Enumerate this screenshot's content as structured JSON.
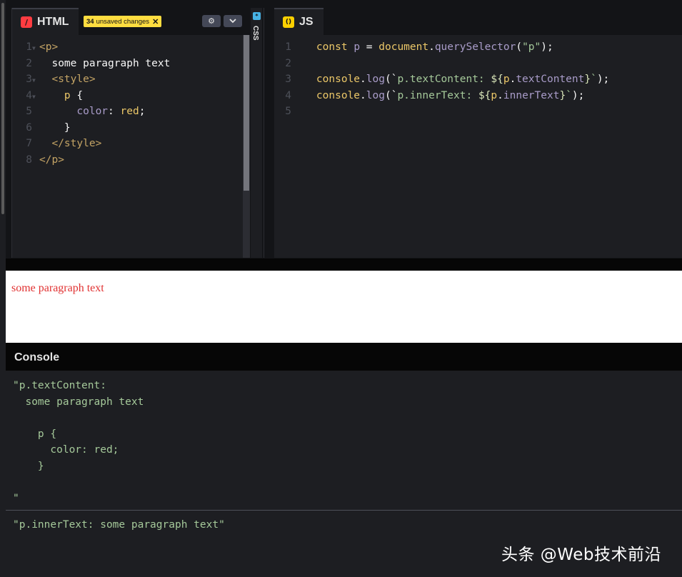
{
  "html_panel": {
    "tab_label": "HTML",
    "tab_icon": "/",
    "unsaved_count": "34",
    "unsaved_text": "unsaved changes",
    "lines": [
      {
        "n": "1",
        "fold": true
      },
      {
        "n": "2",
        "fold": false
      },
      {
        "n": "3",
        "fold": true
      },
      {
        "n": "4",
        "fold": true
      },
      {
        "n": "5",
        "fold": false
      },
      {
        "n": "6",
        "fold": false
      },
      {
        "n": "7",
        "fold": false
      },
      {
        "n": "8",
        "fold": false
      }
    ],
    "code": {
      "l1_tag": "<p>",
      "l2_text": "some paragraph text",
      "l3_tag": "<style>",
      "l4_sel": "p",
      "l4_brace": "{",
      "l5_prop": "color",
      "l5_colon": ":",
      "l5_val": "red",
      "l5_semi": ";",
      "l6_brace": "}",
      "l7_tag": "</style>",
      "l8_tag": "</p>"
    }
  },
  "css_strip": {
    "label": "CSS",
    "icon": "*"
  },
  "js_panel": {
    "tab_label": "JS",
    "tab_icon": "()",
    "line_numbers": [
      "1",
      "2",
      "3",
      "4",
      "5"
    ],
    "code": {
      "l1_kw": "const",
      "l1_var": "p",
      "l1_eq": "=",
      "l1_obj": "document",
      "l1_dot": ".",
      "l1_fn": "querySelector",
      "l1_open": "(",
      "l1_str": "\"p\"",
      "l1_close": ");",
      "l3_obj": "console",
      "l3_dot": ".",
      "l3_fn": "log",
      "l3_open": "(`",
      "l3_str": "p.textContent: ",
      "l3_tpl_open": "${",
      "l3_expr_obj": "p",
      "l3_expr_dot": ".",
      "l3_expr_prop": "textContent",
      "l3_tpl_close": "}",
      "l3_close_tick": "`",
      "l3_close": ");",
      "l4_obj": "console",
      "l4_dot": ".",
      "l4_fn": "log",
      "l4_open": "(`",
      "l4_str": "p.innerText: ",
      "l4_tpl_open": "${",
      "l4_expr_obj": "p",
      "l4_expr_dot": ".",
      "l4_expr_prop": "innerText",
      "l4_tpl_close": "}",
      "l4_close_tick": "`",
      "l4_close": ");"
    }
  },
  "result": {
    "text": "some paragraph text",
    "text_color": "#e13232"
  },
  "console": {
    "title": "Console",
    "entry1": "\"p.textContent: \n  some paragraph text\n\n    p {\n      color: red;\n    }\n\n\"",
    "entry2": "\"p.innerText: some paragraph text\""
  },
  "watermark": "头条 @Web技术前沿",
  "colors": {
    "editor_bg": "#1d1e22",
    "chrome_bg": "#131417",
    "badge_yellow": "#ffdd40",
    "html_icon": "#ff3c41",
    "js_icon": "#fcd000",
    "css_icon": "#47b3e6"
  }
}
